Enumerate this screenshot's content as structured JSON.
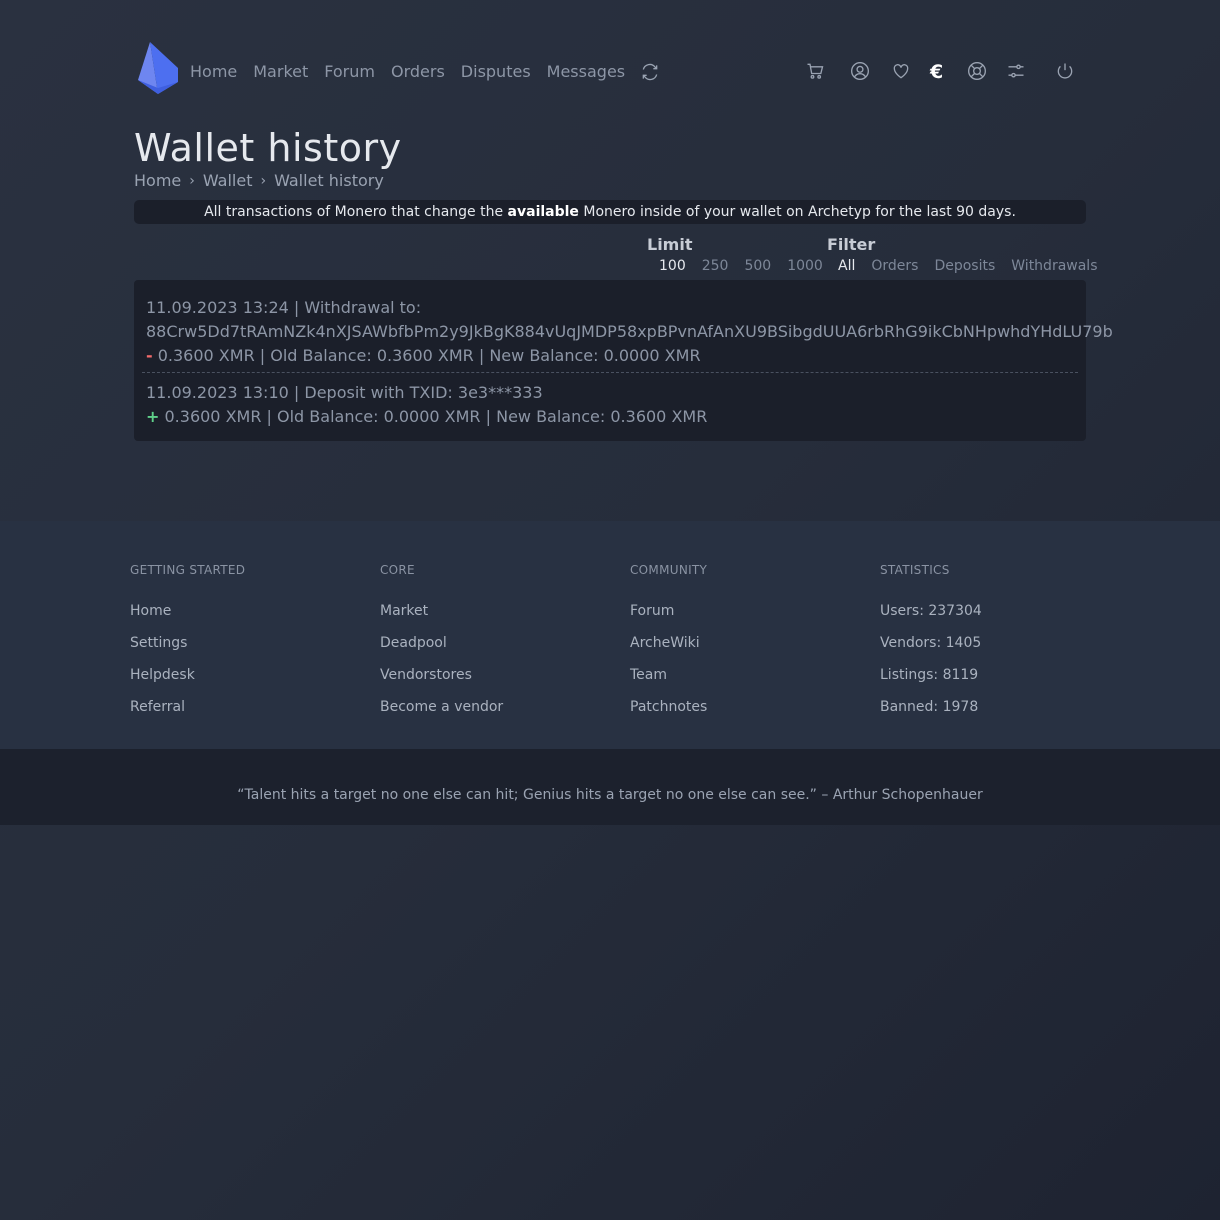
{
  "nav": {
    "links": [
      "Home",
      "Market",
      "Forum",
      "Orders",
      "Disputes",
      "Messages"
    ],
    "icons": [
      "refresh-icon",
      "cart-icon",
      "user-icon",
      "heart-icon",
      "euro-icon",
      "lifebuoy-icon",
      "settings-sliders-icon",
      "power-icon"
    ],
    "currency_symbol": "€"
  },
  "page": {
    "title": "Wallet history",
    "breadcrumb": [
      "Home",
      "Wallet",
      "Wallet history"
    ]
  },
  "info": {
    "prefix": "All transactions of Monero that change the ",
    "emphasis": "available",
    "suffix": " Monero inside of your wallet on Archetyp for the last 90 days."
  },
  "limit": {
    "label": "Limit",
    "options": [
      "100",
      "250",
      "500",
      "1000"
    ],
    "selected": "100"
  },
  "filter": {
    "label": "Filter",
    "options": [
      "All",
      "Orders",
      "Deposits",
      "Withdrawals"
    ],
    "selected": "All"
  },
  "transactions": [
    {
      "header": "11.09.2023 13:24 | Withdrawal to:",
      "address": "88Crw5Dd7tRAmNZk4nXJSAWbfbPm2y9JkBgK884vUqJMDP58xpBPvnAfAnXU9BSibgdUUA6rbRhG9ikCbNHpwhdYHdLU79b",
      "sign": "-",
      "detail": " 0.3600 XMR | Old Balance: 0.3600 XMR | New Balance: 0.0000 XMR"
    },
    {
      "header": "11.09.2023 13:10 | Deposit with TXID: 3e3***333",
      "sign": "+",
      "detail": " 0.3600 XMR | Old Balance: 0.0000 XMR | New Balance: 0.3600 XMR"
    }
  ],
  "footer": {
    "columns": [
      {
        "heading": "GETTING STARTED",
        "items": [
          "Home",
          "Settings",
          "Helpdesk",
          "Referral"
        ]
      },
      {
        "heading": "CORE",
        "items": [
          "Market",
          "Deadpool",
          "Vendorstores",
          "Become a vendor"
        ]
      },
      {
        "heading": "COMMUNITY",
        "items": [
          "Forum",
          "ArcheWiki",
          "Team",
          "Patchnotes"
        ]
      },
      {
        "heading": "STATISTICS",
        "items": [
          "Users: 237304",
          "Vendors: 1405",
          "Listings: 8119",
          "Banned: 1978"
        ]
      }
    ],
    "quote": "“Talent hits a target no one else can hit; Genius hits a target no one else can see.” – Arthur Schopenhauer"
  }
}
